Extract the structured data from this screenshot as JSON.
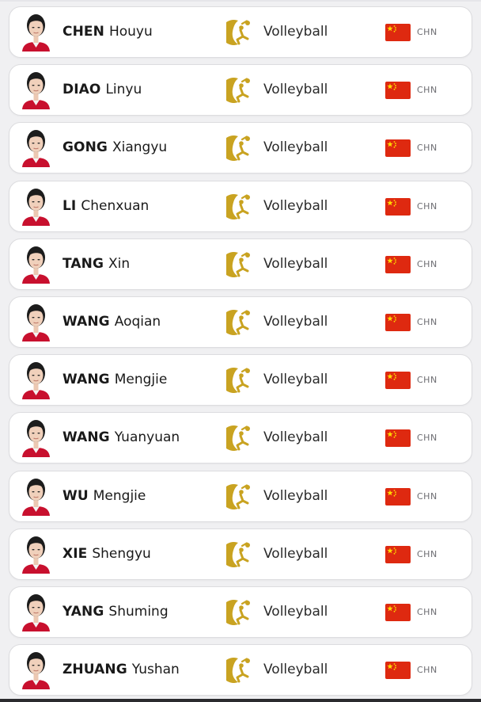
{
  "athletes": [
    {
      "surname": "CHEN",
      "given_name": "Houyu",
      "sport": "Volleyball",
      "noc": "CHN"
    },
    {
      "surname": "DIAO",
      "given_name": "Linyu",
      "sport": "Volleyball",
      "noc": "CHN"
    },
    {
      "surname": "GONG",
      "given_name": "Xiangyu",
      "sport": "Volleyball",
      "noc": "CHN"
    },
    {
      "surname": "LI",
      "given_name": "Chenxuan",
      "sport": "Volleyball",
      "noc": "CHN"
    },
    {
      "surname": "TANG",
      "given_name": "Xin",
      "sport": "Volleyball",
      "noc": "CHN"
    },
    {
      "surname": "WANG",
      "given_name": "Aoqian",
      "sport": "Volleyball",
      "noc": "CHN"
    },
    {
      "surname": "WANG",
      "given_name": "Mengjie",
      "sport": "Volleyball",
      "noc": "CHN"
    },
    {
      "surname": "WANG",
      "given_name": "Yuanyuan",
      "sport": "Volleyball",
      "noc": "CHN"
    },
    {
      "surname": "WU",
      "given_name": "Mengjie",
      "sport": "Volleyball",
      "noc": "CHN"
    },
    {
      "surname": "XIE",
      "given_name": "Shengyu",
      "sport": "Volleyball",
      "noc": "CHN"
    },
    {
      "surname": "YANG",
      "given_name": "Shuming",
      "sport": "Volleyball",
      "noc": "CHN"
    },
    {
      "surname": "ZHUANG",
      "given_name": "Yushan",
      "sport": "Volleyball",
      "noc": "CHN"
    }
  ],
  "icons": {
    "avatar": "athlete-portrait-icon",
    "sport": "volleyball-pictogram-icon",
    "flag": "china-flag-icon"
  },
  "colors": {
    "sport_pictogram": "#c9a321",
    "flag_red": "#de2910",
    "flag_star": "#ffde00",
    "uniform_red": "#c8102e",
    "card_border": "#dcdcdf",
    "page_background": "#f0f0f2"
  }
}
